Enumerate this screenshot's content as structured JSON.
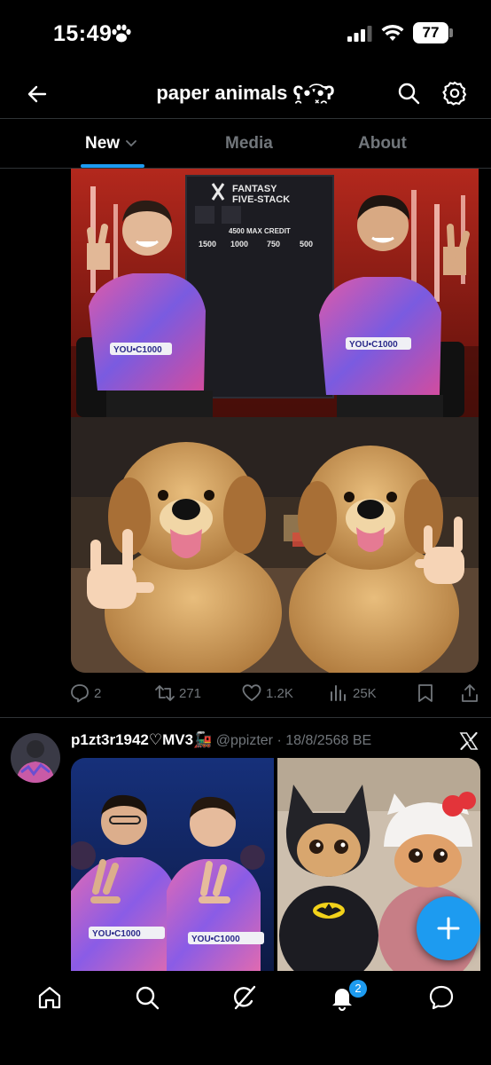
{
  "status_bar": {
    "time": "15:49",
    "battery": "77",
    "icons": [
      "paw-icon",
      "signal-icon",
      "wifi-icon",
      "battery-icon"
    ]
  },
  "header": {
    "title": "paper animals ʕ̯•͡ˑ͓•̯᷅ʔ",
    "back_icon": "arrow-left-icon",
    "search_icon": "search-icon",
    "settings_icon": "gear-icon"
  },
  "tabs": [
    {
      "label": "New",
      "active": true
    },
    {
      "label": "Media",
      "active": false
    },
    {
      "label": "About",
      "active": false
    }
  ],
  "post1": {
    "media": {
      "board_title_line1": "FANTASY",
      "board_title_line2": "FIVE-STACK",
      "board_credit": "4500 MAX CREDIT",
      "board_prices": [
        "1500",
        "1000",
        "750",
        "500"
      ],
      "jersey_text": "YOU•C1000"
    },
    "actions": {
      "replies": "2",
      "reposts": "271",
      "likes": "1.2K",
      "views": "25K"
    }
  },
  "post2": {
    "name": "p1zt3r1942♡MV3🚂",
    "handle": "@ppizter",
    "date": "· 18/8/2568 BE",
    "jersey_text": "YOU•C1000"
  },
  "bottom_nav": {
    "items": [
      "home-icon",
      "search-icon",
      "grok-icon",
      "bell-icon",
      "messages-icon"
    ],
    "notification_count": "2"
  },
  "colors": {
    "accent": "#1d9bf0",
    "muted": "#71767b",
    "divider": "#2f3336",
    "background": "#000000"
  }
}
